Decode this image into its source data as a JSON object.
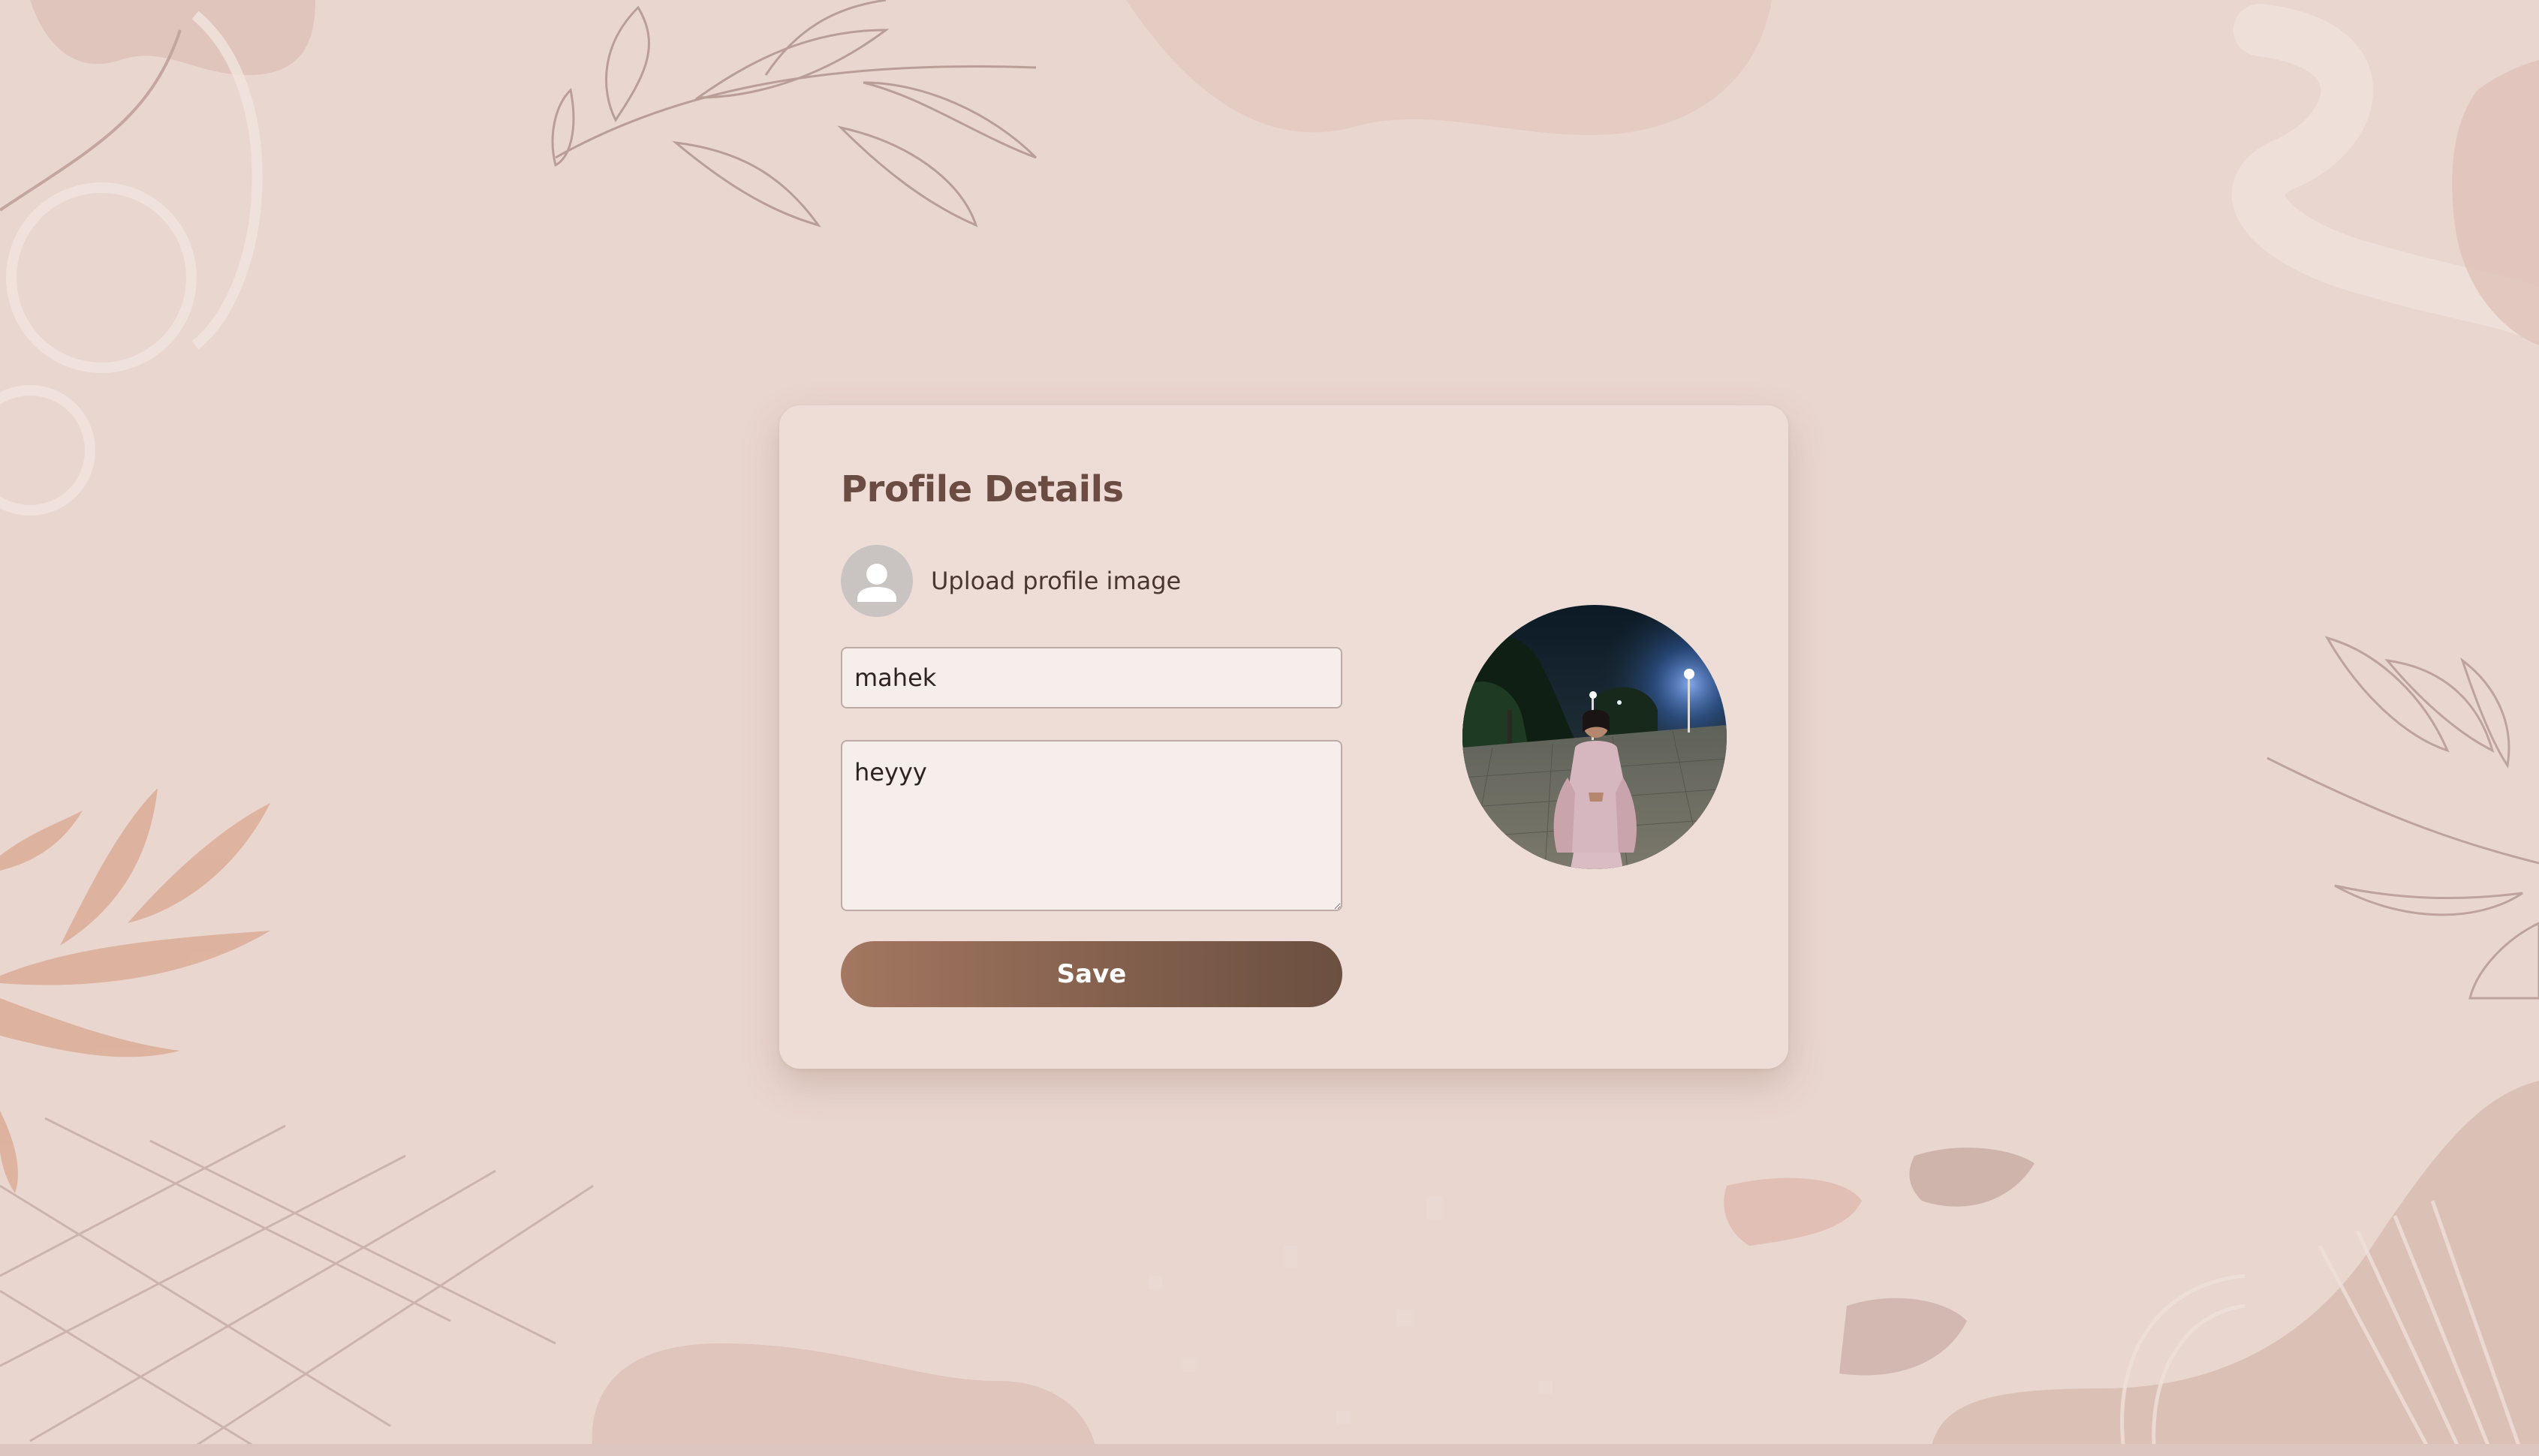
{
  "profile": {
    "title": "Profile Details",
    "upload_label": "Upload profile image",
    "name_value": "mahek",
    "bio_value": "heyyy",
    "save_label": "Save"
  },
  "icons": {
    "placeholder_avatar": "user-icon"
  },
  "colors": {
    "background": "#e9d6cf",
    "card": "#eeddd7",
    "title": "#6b4c42",
    "button_start": "#a37760",
    "button_end": "#6b4f40"
  }
}
